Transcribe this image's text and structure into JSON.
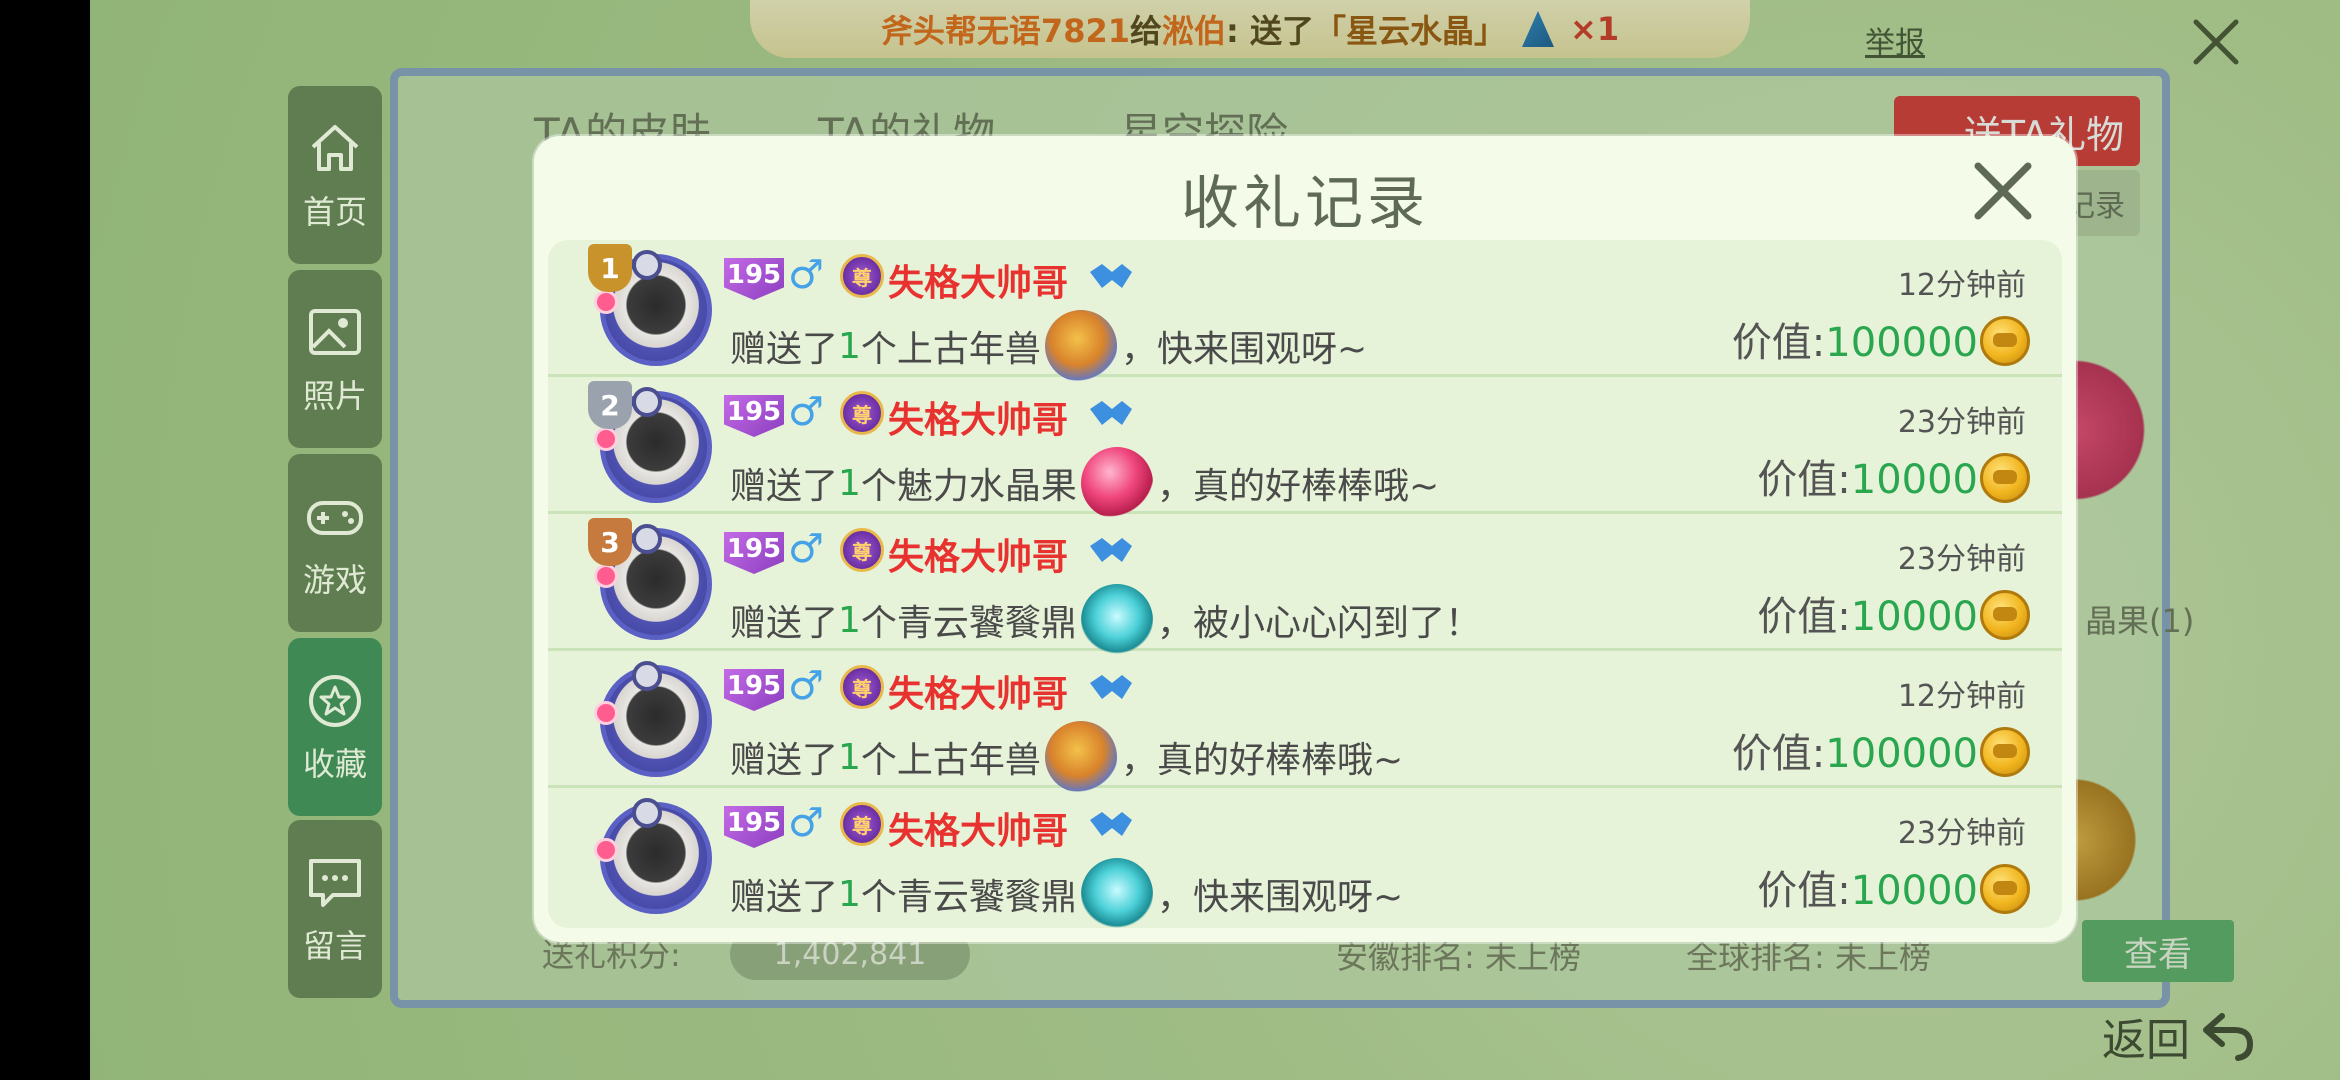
{
  "banner": {
    "sender": "斧头帮无语7821",
    "connector": "给",
    "receiver": "淞伯",
    "action": ":  送了",
    "gift": "「星云水晶」",
    "times": "×1"
  },
  "header": {
    "report_label": "举报"
  },
  "sidebar": {
    "items": [
      {
        "label": "首页",
        "icon": "home-icon"
      },
      {
        "label": "照片",
        "icon": "photo-icon"
      },
      {
        "label": "游戏",
        "icon": "gamepad-icon"
      },
      {
        "label": "收藏",
        "icon": "star-icon",
        "active": true
      },
      {
        "label": "留言",
        "icon": "message-icon"
      }
    ]
  },
  "back_panel": {
    "tabs": [
      "TA的皮肤",
      "TA的礼物",
      "星空探险"
    ],
    "send_gift_label": "送TA礼物",
    "records_tab_label": "收礼记录",
    "peek_label": "晶果(1)",
    "score_label": "送礼积分:",
    "score_value": "1,402,841",
    "rank_anhui": "安徽排名: 未上榜",
    "rank_world": "全球排名: 未上榜",
    "view_label": "查看",
    "back_label": "返回"
  },
  "dialog": {
    "title": "收礼记录",
    "rows": [
      {
        "rank": "1",
        "level": "195",
        "gender": "♂",
        "vip": "尊",
        "username": "失格大帅哥",
        "msg_prefix": "赠送了",
        "count": "1",
        "msg_unit": "个上古年兽",
        "gift_icon": "ancient-beast",
        "msg_suffix": "，快来围观呀~",
        "time": "12分钟前",
        "value_label": "价值:",
        "value": "100000"
      },
      {
        "rank": "2",
        "level": "195",
        "gender": "♂",
        "vip": "尊",
        "username": "失格大帅哥",
        "msg_prefix": "赠送了",
        "count": "1",
        "msg_unit": "个魅力水晶果",
        "gift_icon": "crystal-fruit",
        "msg_suffix": "，真的好棒棒哦~",
        "time": "23分钟前",
        "value_label": "价值:",
        "value": "10000"
      },
      {
        "rank": "3",
        "level": "195",
        "gender": "♂",
        "vip": "尊",
        "username": "失格大帅哥",
        "msg_prefix": "赠送了",
        "count": "1",
        "msg_unit": "个青云饕餮鼎",
        "gift_icon": "taotie-cauldron",
        "msg_suffix": "，被小心心闪到了！",
        "time": "23分钟前",
        "value_label": "价值:",
        "value": "10000"
      },
      {
        "rank": "",
        "level": "195",
        "gender": "♂",
        "vip": "尊",
        "username": "失格大帅哥",
        "msg_prefix": "赠送了",
        "count": "1",
        "msg_unit": "个上古年兽",
        "gift_icon": "ancient-beast",
        "msg_suffix": "，真的好棒棒哦~",
        "time": "12分钟前",
        "value_label": "价值:",
        "value": "100000"
      },
      {
        "rank": "",
        "level": "195",
        "gender": "♂",
        "vip": "尊",
        "username": "失格大帅哥",
        "msg_prefix": "赠送了",
        "count": "1",
        "msg_unit": "个青云饕餮鼎",
        "gift_icon": "taotie-cauldron",
        "msg_suffix": "，快来围观呀~",
        "time": "23分钟前",
        "value_label": "价值:",
        "value": "10000"
      }
    ]
  },
  "colors": {
    "username": "#e8322f",
    "count": "#2aa64f",
    "value": "#2aa64f",
    "rank1": "#c9932b",
    "rank2": "#9aa3ad",
    "rank3": "#c77a3d"
  }
}
